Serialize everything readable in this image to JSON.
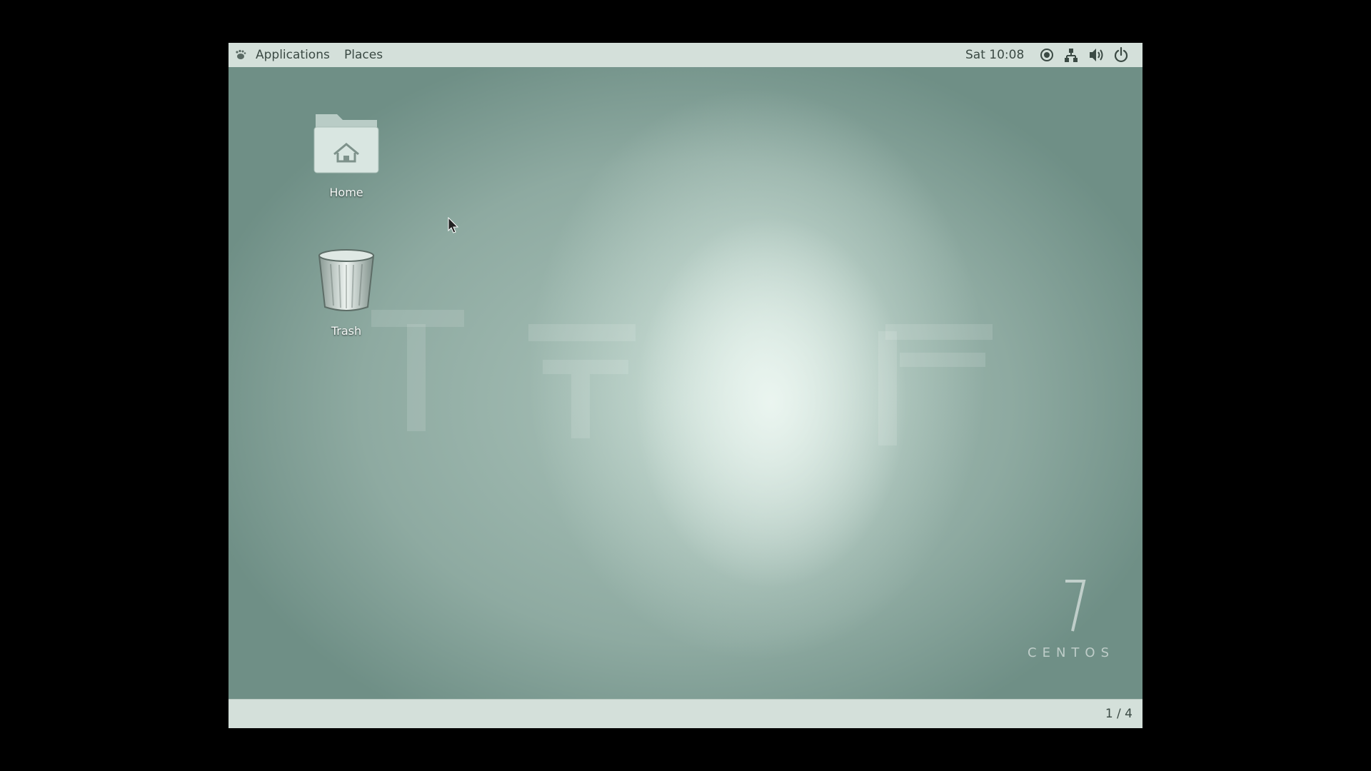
{
  "top_bar": {
    "applications_label": "Applications",
    "places_label": "Places",
    "clock": "Sat 10:08"
  },
  "desktop": {
    "icons": [
      {
        "label": "Home",
        "icon": "home-folder-icon"
      },
      {
        "label": "Trash",
        "icon": "trash-icon"
      }
    ],
    "wallpaper_brand": {
      "number": "7",
      "text": "CENTOS"
    }
  },
  "bottom_bar": {
    "workspace_indicator": "1 / 4"
  },
  "colors": {
    "panel": "#d4e0da",
    "panel_text": "#3b4a44",
    "desktop_mid": "#a9c2b9",
    "desktop_edge": "#6f8f86",
    "desktop_center": "#ecf6f1"
  }
}
